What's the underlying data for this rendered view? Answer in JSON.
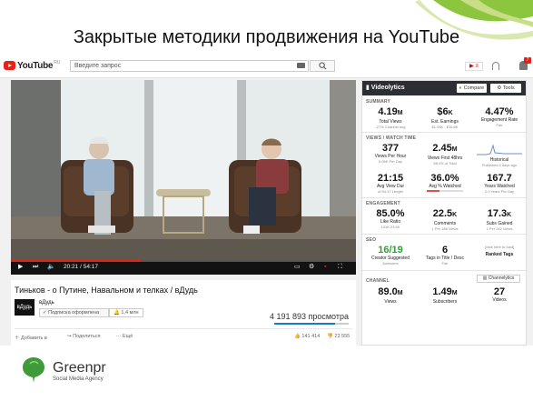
{
  "slide": {
    "title": "Закрытые методики продвижения на YouTube"
  },
  "youtube": {
    "logo_text": "YouTube",
    "logo_suffix": "RU",
    "search_placeholder": "Введите запрос",
    "notifications_count": "7"
  },
  "player": {
    "current_time": "20:21",
    "duration": "54:17",
    "progress": 0.375
  },
  "video": {
    "title": "Тиньков - о Путине, Навальном и телках / вДудь",
    "channel_logo": "вДудь",
    "channel_name": "вДудь",
    "subscribe_label": "Подписка оформлена",
    "subscriber_count": "1,4 млн",
    "views": "4 191 893 просмотра",
    "add_label": "Добавить в",
    "share_label": "Поделиться",
    "more_label": "Ещё",
    "likes": "141 414",
    "dislikes": "23 555"
  },
  "vidiq": {
    "brand": "Videolytics",
    "compare_label": "Compare",
    "tools_label": "Tools",
    "sections": {
      "summary": "SUMMARY",
      "views_watch": "VIEWS / WATCH TIME",
      "engagement": "ENGAGEMENT",
      "seo": "SEO",
      "channel": "CHANNEL"
    },
    "summary": [
      {
        "value": "4.19",
        "unit": "M",
        "label": "Total Views",
        "sub": "-27% Channel avg"
      },
      {
        "value": "$6",
        "unit": "K",
        "label": "Est. Earnings",
        "sub": "$1.05K - $16.8K"
      },
      {
        "value": "4.47%",
        "unit": "",
        "label": "Engagement Rate",
        "sub": "Fair"
      }
    ],
    "views_row1": [
      {
        "value": "377",
        "unit": "",
        "label": "Views Per Hour",
        "sub": "9.05K Per Day"
      },
      {
        "value": "2.45",
        "unit": "M",
        "label": "Views First 48hrs",
        "sub": "58.4% of Total"
      },
      {
        "value": "",
        "unit": "",
        "label": "Historical",
        "sub": "Published 4 days ago"
      }
    ],
    "views_row2": [
      {
        "value": "21:15",
        "unit": "",
        "label": "Avg View Dur",
        "sub": "of 54:17 Length",
        "pct": 0.39
      },
      {
        "value": "36.0%",
        "unit": "",
        "label": "Avg % Watched",
        "sub": "",
        "pct": 0.36
      },
      {
        "value": "167.7",
        "unit": "",
        "label": "Years Watched",
        "sub": "2.0 Years Per Day"
      }
    ],
    "engagement": [
      {
        "value": "85.0%",
        "unit": "",
        "label": "Like Ratio",
        "sub": "141K   23.5K"
      },
      {
        "value": "22.5",
        "unit": "K",
        "label": "Comments",
        "sub": "1 Per 186 Views"
      },
      {
        "value": "17.3",
        "unit": "K",
        "label": "Subs Gained",
        "sub": "1 Per 242 Views"
      }
    ],
    "seo": [
      {
        "value": "16/19",
        "unit": "",
        "label": "Creator Suggested",
        "sub": "Awesome"
      },
      {
        "value": "6",
        "unit": "",
        "label": "Tags in Title / Desc",
        "sub": "Fair"
      },
      {
        "value": "",
        "unit": "",
        "label": "Ranked Tags",
        "sub": "click here to load"
      }
    ],
    "channel_button": "Channelytics",
    "channel": [
      {
        "value": "89.0",
        "unit": "M",
        "label": "Views"
      },
      {
        "value": "1.49",
        "unit": "M",
        "label": "Subscribers"
      },
      {
        "value": "27",
        "unit": "",
        "label": "Videos"
      }
    ]
  },
  "footer": {
    "brand": "Greenpr",
    "tagline": "Social Media Agency"
  },
  "colors": {
    "youtube_red": "#e62117",
    "vidiq_header": "#2b2f33",
    "seo_green": "#27a52f",
    "brand_green": "#3f9b3a"
  }
}
